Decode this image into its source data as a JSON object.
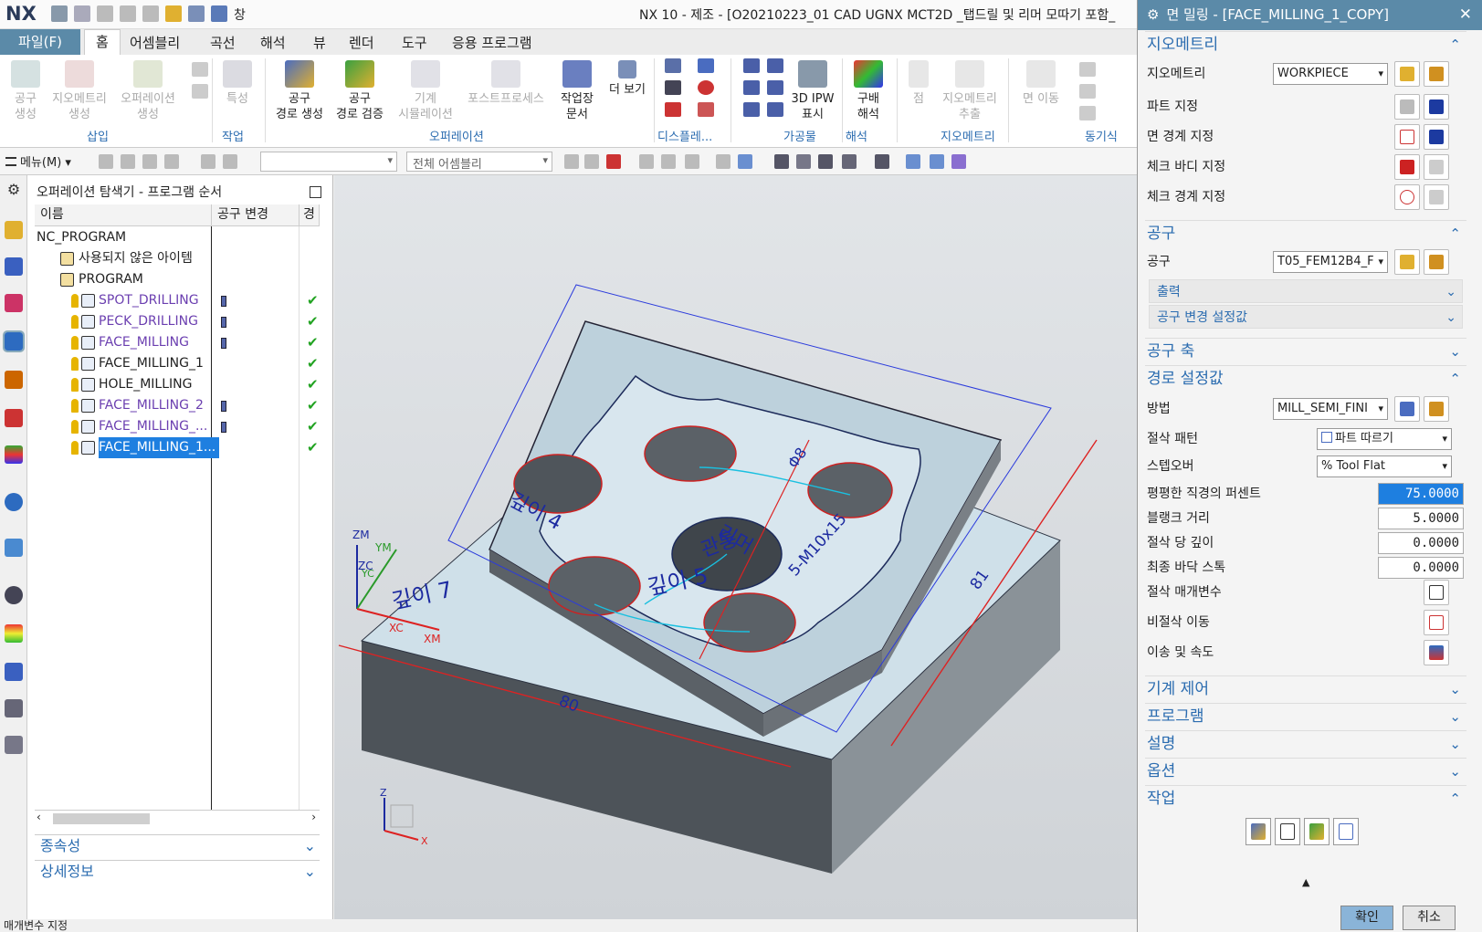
{
  "app": {
    "logo": "NX",
    "window_title": "NX 10 - 제조 - [O20210223_01 CAD UGNX MCT2D _탭드릴 및 리머 모따기 포함_",
    "qat_label": "창"
  },
  "menu": {
    "file": "파일(F)",
    "tabs": [
      "홈",
      "어셈블리",
      "곡선",
      "해석",
      "뷰",
      "렌더",
      "도구",
      "응용 프로그램"
    ]
  },
  "ribbon": {
    "buttons": [
      {
        "label": "공구\n생성",
        "disabled": true
      },
      {
        "label": "지오메트리\n생성",
        "disabled": true
      },
      {
        "label": "오퍼레이션\n생성",
        "disabled": true
      },
      {
        "label": "특성",
        "disabled": true
      },
      {
        "label": "공구\n경로 생성",
        "disabled": false
      },
      {
        "label": "공구\n경로 검증",
        "disabled": false
      },
      {
        "label": "기계\n시뮬레이션",
        "disabled": true
      },
      {
        "label": "포스트프로세스",
        "disabled": true
      },
      {
        "label": "작업장\n문서",
        "disabled": false
      },
      {
        "label": "더 보기",
        "disabled": false
      },
      {
        "label": "3D IPW\n표시",
        "disabled": false
      },
      {
        "label": "구배\n해석",
        "disabled": false
      },
      {
        "label": "점",
        "disabled": true
      },
      {
        "label": "지오메트리\n추출",
        "disabled": true
      },
      {
        "label": "면 이동",
        "disabled": true
      }
    ],
    "groups": [
      "삽입",
      "작업",
      "오퍼레이션",
      "디스플레...",
      "가공물",
      "해석",
      "지오메트리",
      "동기식"
    ]
  },
  "toolbar2": {
    "menu": "메뉴(M)",
    "combo1": "",
    "combo2": "전체 어셈블리"
  },
  "navigator": {
    "title": "오퍼레이션 탐색기 - 프로그램 순서",
    "columns": [
      "이름",
      "공구 변경",
      "경"
    ],
    "rows": [
      {
        "name": "NC_PROGRAM",
        "indent": 0,
        "kind": "root"
      },
      {
        "name": "사용되지 않은 아이템",
        "indent": 1,
        "kind": "folder"
      },
      {
        "name": "PROGRAM",
        "indent": 1,
        "kind": "folder"
      },
      {
        "name": "SPOT_DRILLING",
        "indent": 2,
        "kind": "op",
        "tool_change": true,
        "done": true
      },
      {
        "name": "PECK_DRILLING",
        "indent": 2,
        "kind": "op",
        "tool_change": true,
        "done": true
      },
      {
        "name": "FACE_MILLING",
        "indent": 2,
        "kind": "op",
        "tool_change": true,
        "done": true
      },
      {
        "name": "FACE_MILLING_1",
        "indent": 2,
        "kind": "plain",
        "tool_change": false,
        "done": true
      },
      {
        "name": "HOLE_MILLING",
        "indent": 2,
        "kind": "plain",
        "tool_change": false,
        "done": true
      },
      {
        "name": "FACE_MILLING_2",
        "indent": 2,
        "kind": "op",
        "tool_change": true,
        "done": true
      },
      {
        "name": "FACE_MILLING_...",
        "indent": 2,
        "kind": "op",
        "tool_change": true,
        "done": true
      },
      {
        "name": "FACE_MILLING_1...",
        "indent": 2,
        "kind": "sel",
        "tool_change": false,
        "done": true
      }
    ],
    "sections": [
      "종속성",
      "상세정보"
    ]
  },
  "viewport": {
    "labels": {
      "depth4": "깊이 4",
      "depth5": "깊이 5",
      "depth7": "깊이 7",
      "reamer": "리머",
      "through": "관통",
      "thread": "5-M10x15",
      "diameter": "Φ8",
      "dim80": "80",
      "dim81": "81"
    },
    "axes": {
      "zm": "ZM",
      "ym": "YM",
      "zc": "ZC",
      "yc": "YC",
      "xc": "XC",
      "xm": "XM",
      "z": "Z",
      "x": "X"
    }
  },
  "status": {
    "text": "매개변수 지정"
  },
  "dialog": {
    "title": "면 밀링 - [FACE_MILLING_1_COPY]",
    "geometry": {
      "header": "지오메트리",
      "geometry_label": "지오메트리",
      "geometry_value": "WORKPIECE",
      "rows": [
        "파트 지정",
        "면 경계 지정",
        "체크 바디 지정",
        "체크 경계 지정"
      ]
    },
    "tool": {
      "header": "공구",
      "tool_label": "공구",
      "tool_value": "T05_FEM12B4_F",
      "sub": [
        "출력",
        "공구 변경 설정값"
      ]
    },
    "tool_axis": "공구 축",
    "path": {
      "header": "경로 설정값",
      "method_label": "방법",
      "method_value": "MILL_SEMI_FINI",
      "cut_pattern_label": "절삭 패턴",
      "cut_pattern_value": "파트 따르기",
      "stepover_label": "스텝오버",
      "stepover_value": "% Tool Flat",
      "params": [
        {
          "label": "평평한 직경의 퍼센트",
          "value": "75.0000",
          "selected": true
        },
        {
          "label": "블랭크 거리",
          "value": "5.0000",
          "selected": false
        },
        {
          "label": "절삭 당 깊이",
          "value": "0.0000",
          "selected": false
        },
        {
          "label": "최종 바닥 스톡",
          "value": "0.0000",
          "selected": false
        }
      ],
      "buttons": [
        "절삭 매개변수",
        "비절삭 이동",
        "이송 및 속도"
      ]
    },
    "collapsed": [
      "기계 제어",
      "프로그램",
      "설명",
      "옵션"
    ],
    "action": "작업",
    "ok": "확인",
    "cancel": "취소"
  },
  "colors": {
    "accent": "#5b8aa8",
    "link": "#2b6cb0",
    "selection": "#1e7fe0",
    "check": "#22a322"
  }
}
